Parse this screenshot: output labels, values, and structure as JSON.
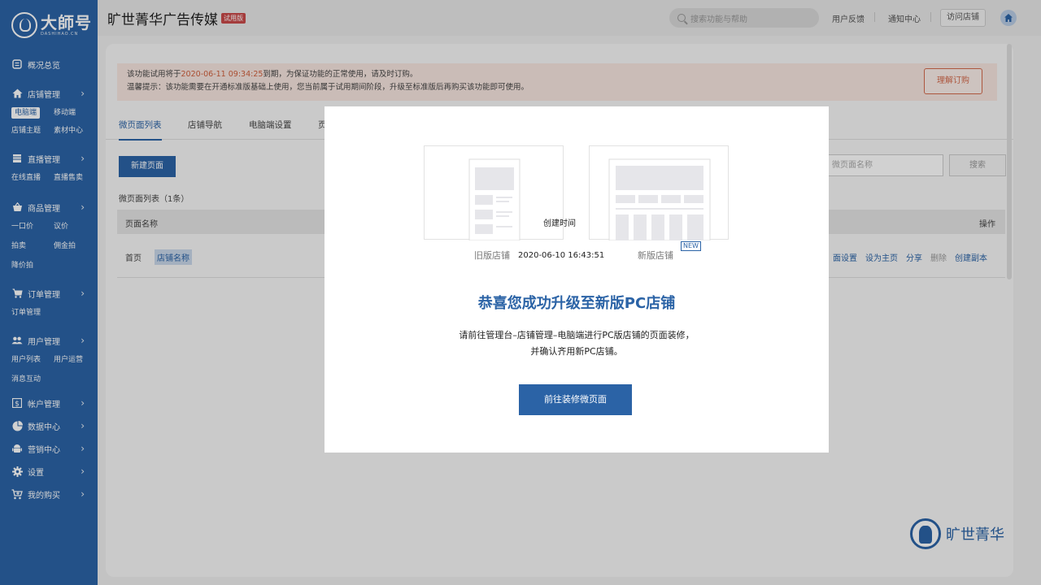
{
  "brand": {
    "logo_text": "大師号",
    "logo_sub": "DASHIHAO.CN",
    "title": "旷世菁华广告传媒",
    "trial_badge": "试用版"
  },
  "topbar": {
    "search_placeholder": "搜索功能与帮助",
    "feedback": "用户反馈",
    "notifications": "通知中心",
    "visit_store": "访问店铺"
  },
  "sidebar": {
    "overview": "概况总览",
    "groups": [
      {
        "label": "店铺管理",
        "icon": "home-icon",
        "subs": [
          "电脑端",
          "移动端",
          "店铺主题",
          "素材中心"
        ]
      },
      {
        "label": "直播管理",
        "icon": "live-icon",
        "subs": [
          "在线直播",
          "直播售卖"
        ]
      },
      {
        "label": "商品管理",
        "icon": "basket-icon",
        "subs": [
          "一口价",
          "议价",
          "拍卖",
          "佣金拍",
          "降价拍"
        ]
      },
      {
        "label": "订单管理",
        "icon": "cart-icon",
        "subs": [
          "订单管理"
        ]
      },
      {
        "label": "用户管理",
        "icon": "users-icon",
        "subs": [
          "用户列表",
          "用户运营",
          "消息互动"
        ]
      },
      {
        "label": "帐户管理",
        "icon": "dollar-icon",
        "subs": []
      },
      {
        "label": "数据中心",
        "icon": "pie-icon",
        "subs": []
      },
      {
        "label": "营销中心",
        "icon": "android-icon",
        "subs": []
      },
      {
        "label": "设置",
        "icon": "gear-icon",
        "subs": []
      },
      {
        "label": "我的购买",
        "icon": "purchase-cart-icon",
        "subs": []
      }
    ]
  },
  "notice": {
    "line1_pre": "该功能试用将于",
    "line1_date": "2020-06-11 09:34:25",
    "line1_post": "到期，为保证功能的正常使用，请及时订购。",
    "line2": "温馨提示：该功能需要在开通标准版基础上使用，您当前属于试用期间阶段，升级至标准版后再购买该功能即可使用。",
    "button": "理解订购"
  },
  "tabs": [
    "微页面列表",
    "店铺导航",
    "电脑端设置",
    "页"
  ],
  "page_list": {
    "new_button": "新建页面",
    "count_label": "微页面列表（1条）",
    "search_placeholder": "微页面名称",
    "search_button": "搜索",
    "headers": {
      "name": "页面名称",
      "created": "创建时间",
      "ops": "操作"
    },
    "rows": [
      {
        "name": "首页",
        "tag": "店铺名称",
        "created": "2020-06-10 16:43:51",
        "ops": [
          "面设置",
          "设为主页",
          "分享",
          "删除",
          "创建副本"
        ]
      }
    ]
  },
  "modal": {
    "old_caption": "旧版店铺",
    "new_caption": "新版店铺",
    "new_tag": "NEW",
    "title": "恭喜您成功升级至新版PC店铺",
    "desc_line1": "请前往管理台–店铺管理–电脑端进行PC版店铺的页面装修，",
    "desc_line2": "并确认齐用新PC店铺。",
    "button": "前往装修微页面"
  },
  "corner_logo": {
    "text": "旷世菁华"
  },
  "colors": {
    "accent": "#2b63a6",
    "warning": "#d0603d"
  }
}
